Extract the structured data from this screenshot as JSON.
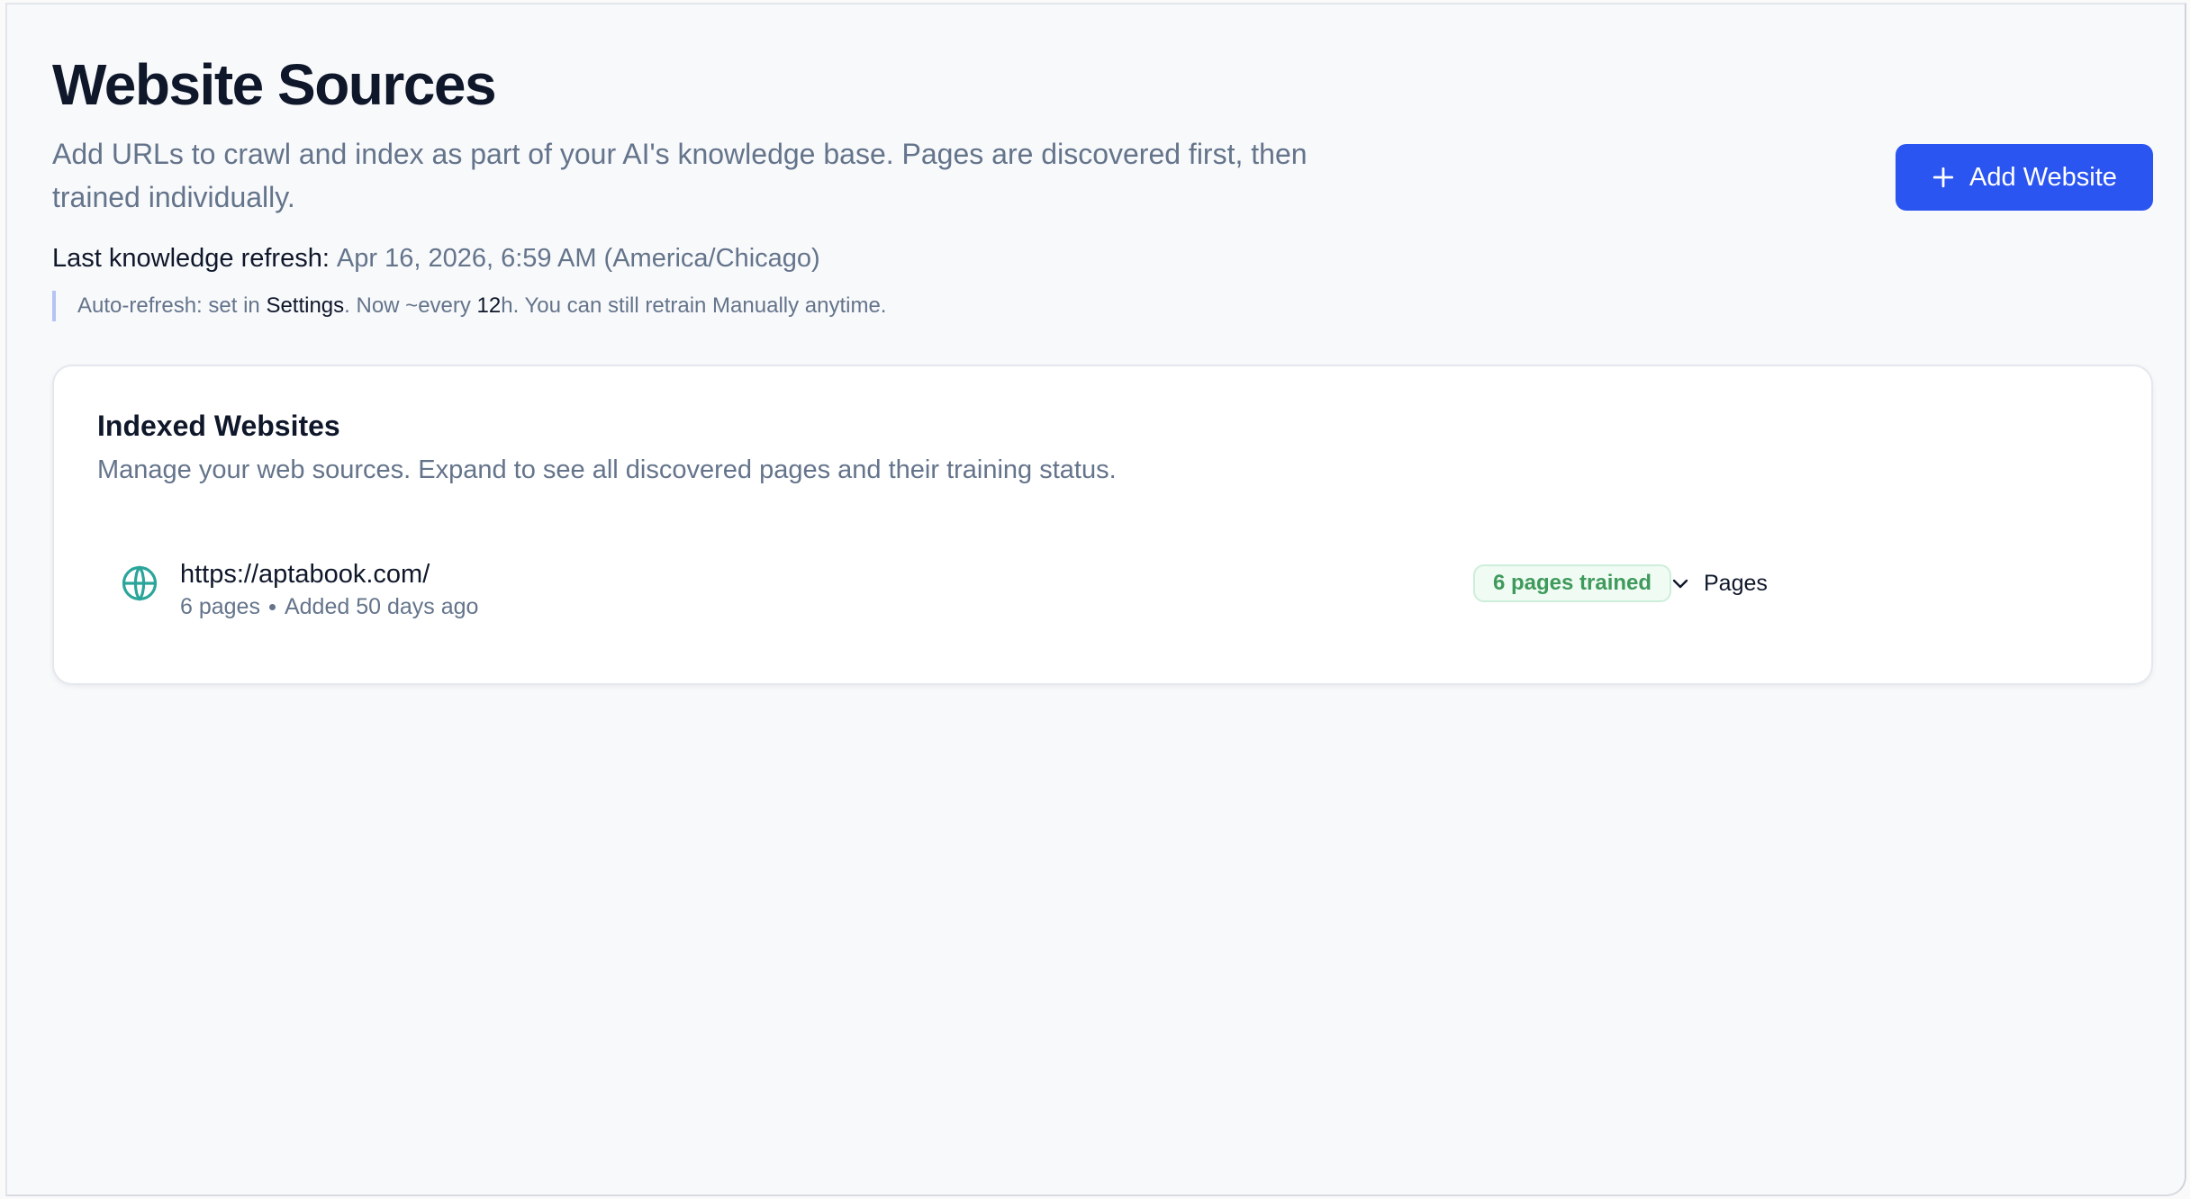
{
  "header": {
    "title": "Website Sources",
    "subtitle": "Add URLs to crawl and index as part of your AI's knowledge base. Pages are discovered first, then trained individually.",
    "last_refresh_label": "Last knowledge refresh:",
    "last_refresh_value": "Apr 16, 2026, 6:59 AM (America/Chicago)",
    "auto_refresh": {
      "prefix": "Auto-refresh: set in ",
      "settings_link": "Settings",
      "middle": ". Now ~every ",
      "interval": "12",
      "suffix": "h. You can still retrain Manually anytime."
    },
    "add_button_label": "Add Website"
  },
  "card": {
    "title": "Indexed Websites",
    "subtitle": "Manage your web sources. Expand to see all discovered pages and their training status.",
    "sites": [
      {
        "url": "https://aptabook.com/",
        "pages_count": "6 pages",
        "added": "Added 50 days ago",
        "status": "6 pages trained",
        "toggle_label": "Pages"
      }
    ]
  },
  "colors": {
    "accent": "#2b55f0",
    "success": "#3f9a5b",
    "globe": "#2aa59a"
  },
  "icons": {
    "add": "plus-icon",
    "site": "globe-icon",
    "expand": "chevron-down-icon"
  }
}
